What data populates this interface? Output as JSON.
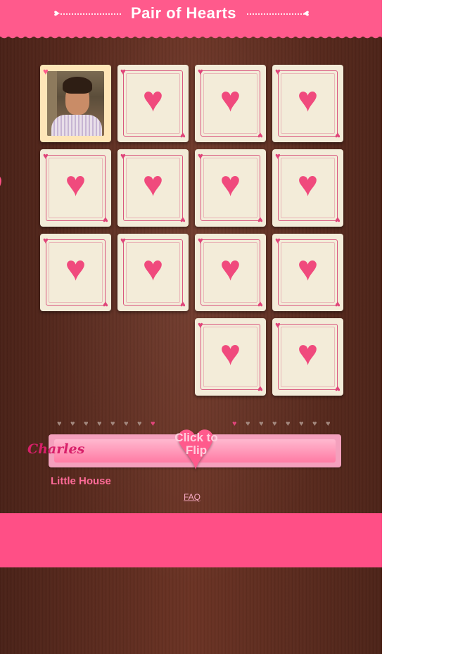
{
  "header": {
    "title": "Pair of Hearts"
  },
  "icons": {
    "heart": "♥",
    "side_heart": "heart-icon",
    "corner": "heart-icon"
  },
  "colors": {
    "brand_pink": "#ff5a8c",
    "board_brown": "#5e2c1f",
    "card_cream": "#f3ecd9",
    "heart_pink": "#f04a7d"
  },
  "cards": [
    {
      "state": "revealed",
      "content": "photo"
    },
    {
      "state": "face-down"
    },
    {
      "state": "face-down"
    },
    {
      "state": "face-down"
    },
    {
      "state": "face-down"
    },
    {
      "state": "face-down"
    },
    {
      "state": "face-down"
    },
    {
      "state": "face-down"
    },
    {
      "state": "face-down"
    },
    {
      "state": "face-down"
    },
    {
      "state": "face-down"
    },
    {
      "state": "face-down"
    },
    {
      "state": "face-down"
    },
    {
      "state": "face-down"
    }
  ],
  "progress": {
    "left": {
      "total": 8,
      "active_index": 7
    },
    "right": {
      "total": 8,
      "active_index": 0
    }
  },
  "player": {
    "name": "Charles",
    "subtitle": "Little House"
  },
  "flip_button": {
    "line1": "Click to",
    "line2": "Flip"
  },
  "links": {
    "faq": "FAQ"
  }
}
